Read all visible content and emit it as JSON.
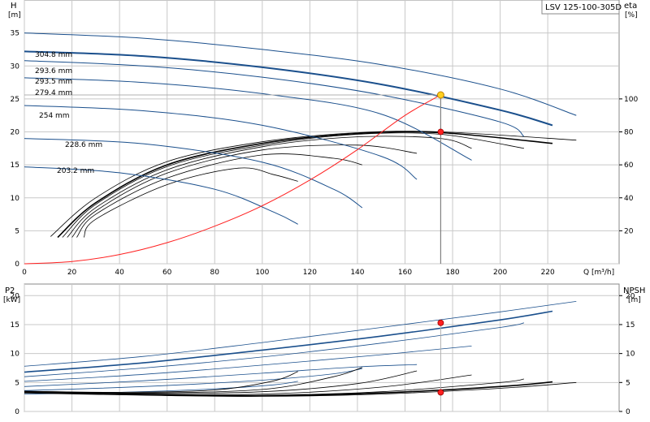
{
  "chart_data": [
    {
      "id": "head",
      "type": "line",
      "title": "LSV 125-100-305D",
      "left_axis_title": "H",
      "left_axis_unit": "[m]",
      "right_axis_title": "eta",
      "right_axis_unit": "[%]",
      "xlabel": "Q [m³/h]",
      "xlim": [
        0,
        250
      ],
      "ylim": [
        0,
        40
      ],
      "y2lim": [
        0,
        160
      ],
      "xticks": [
        0,
        20,
        40,
        60,
        80,
        100,
        120,
        140,
        160,
        180,
        200,
        220
      ],
      "yticks": [
        0,
        5,
        10,
        15,
        20,
        25,
        30,
        35
      ],
      "y2ticks": [
        20,
        40,
        60,
        80,
        100
      ],
      "grid": true,
      "colors": {
        "blue": "#1a4f8c",
        "black": "#000000",
        "red": "#ff2020",
        "duty_marker": "#ffd020",
        "grid": "#c8c8c8"
      },
      "series": [
        {
          "name": "304.8 mm",
          "x": [
            0,
            50,
            100,
            150,
            200,
            232
          ],
          "y": [
            35.0,
            34.2,
            32.5,
            30.2,
            26.5,
            22.5
          ]
        },
        {
          "name": "293.6 mm",
          "x": [
            0,
            50,
            100,
            150,
            200,
            222
          ],
          "y": [
            32.2,
            31.5,
            29.8,
            27.2,
            23.3,
            21.0
          ]
        },
        {
          "name": "293.5 mm",
          "x": [
            0,
            50,
            100,
            150,
            200,
            210
          ],
          "y": [
            30.8,
            30.0,
            28.3,
            25.6,
            21.5,
            19.3
          ]
        },
        {
          "name": "279.4 mm",
          "x": [
            0,
            50,
            100,
            150,
            188
          ],
          "y": [
            28.2,
            27.5,
            25.8,
            22.7,
            15.7
          ]
        },
        {
          "name": "254 mm",
          "x": [
            0,
            50,
            100,
            150,
            165
          ],
          "y": [
            24.0,
            23.2,
            21.0,
            16.3,
            12.8
          ]
        },
        {
          "name": "228.6 mm",
          "x": [
            0,
            50,
            100,
            130,
            142
          ],
          "y": [
            19.0,
            18.2,
            15.4,
            11.3,
            8.5
          ]
        },
        {
          "name": "203.2 mm",
          "x": [
            0,
            40,
            80,
            105,
            115
          ],
          "y": [
            14.7,
            13.8,
            11.3,
            7.8,
            6.0
          ]
        }
      ],
      "efficiency_curves": [
        {
          "x": [
            11,
            30,
            60,
            100,
            140,
            175,
            232
          ],
          "y": [
            16.5,
            40,
            62,
            74,
            79.5,
            80,
            75
          ]
        },
        {
          "x": [
            14,
            30,
            60,
            100,
            140,
            175,
            222
          ],
          "y": [
            16,
            37,
            60,
            73,
            79,
            79.5,
            73
          ]
        },
        {
          "x": [
            16,
            30,
            60,
            100,
            140,
            175,
            210
          ],
          "y": [
            16,
            36,
            59,
            72,
            78.5,
            78.5,
            70
          ]
        },
        {
          "x": [
            18,
            30,
            60,
            100,
            140,
            175,
            188
          ],
          "y": [
            16,
            34,
            57,
            71,
            77,
            76,
            70
          ]
        },
        {
          "x": [
            20,
            30,
            60,
            100,
            140,
            165
          ],
          "y": [
            16,
            32,
            55,
            69,
            72,
            67
          ]
        },
        {
          "x": [
            22,
            30,
            60,
            100,
            130,
            142
          ],
          "y": [
            16,
            30,
            52,
            66,
            64,
            60
          ]
        },
        {
          "x": [
            25,
            30,
            60,
            90,
            105,
            115
          ],
          "y": [
            16,
            27,
            48,
            58,
            54,
            50
          ]
        }
      ],
      "system_curve": {
        "x": [
          0,
          20,
          40,
          60,
          80,
          100,
          120,
          140,
          160,
          175
        ],
        "y": [
          0,
          0.35,
          1.4,
          3.2,
          5.7,
          8.8,
          12.7,
          17.3,
          22.5,
          25.6
        ]
      },
      "duty_point": {
        "q": 175,
        "h": 25.6,
        "eta": 80
      },
      "curve_labels": [
        "304.8 mm",
        "293.6 mm",
        "293.5 mm",
        "279.4 mm",
        "254 mm",
        "228.6 mm",
        "203.2 mm"
      ]
    },
    {
      "id": "power",
      "type": "line",
      "left_axis_title": "P2",
      "left_axis_unit": "[kW]",
      "right_axis_title": "NPSH",
      "right_axis_unit": "[m]",
      "xlim": [
        0,
        250
      ],
      "ylim": [
        0,
        22
      ],
      "y2lim": [
        0,
        22
      ],
      "yticks": [
        0,
        5,
        10,
        15,
        20
      ],
      "y2ticks": [
        0,
        5,
        10,
        15,
        20
      ],
      "grid": true,
      "series": [
        {
          "x": [
            0,
            50,
            100,
            150,
            200,
            232
          ],
          "y": [
            7.8,
            9.5,
            11.9,
            14.5,
            17.2,
            19.0
          ]
        },
        {
          "x": [
            0,
            50,
            100,
            150,
            200,
            222
          ],
          "y": [
            6.8,
            8.4,
            10.6,
            13.0,
            15.8,
            17.3
          ]
        },
        {
          "x": [
            0,
            50,
            100,
            150,
            200,
            210
          ],
          "y": [
            6.0,
            7.5,
            9.4,
            11.8,
            14.5,
            15.3
          ]
        },
        {
          "x": [
            0,
            50,
            100,
            150,
            188
          ],
          "y": [
            5.2,
            6.4,
            8.0,
            9.8,
            11.3
          ]
        },
        {
          "x": [
            0,
            50,
            100,
            140,
            165
          ],
          "y": [
            4.3,
            5.3,
            6.6,
            7.7,
            8.1
          ]
        },
        {
          "x": [
            0,
            50,
            100,
            130,
            142
          ],
          "y": [
            3.6,
            4.3,
            5.4,
            6.5,
            7.4
          ]
        },
        {
          "x": [
            0,
            40,
            80,
            105,
            115
          ],
          "y": [
            3.0,
            3.3,
            3.9,
            4.6,
            5.2
          ]
        }
      ],
      "npsh_curves": [
        {
          "x": [
            0,
            50,
            100,
            150,
            200,
            232
          ],
          "y": [
            3.2,
            2.8,
            2.6,
            3.0,
            4.0,
            5.0
          ]
        },
        {
          "x": [
            0,
            50,
            100,
            150,
            200,
            222
          ],
          "y": [
            3.3,
            2.9,
            2.7,
            3.2,
            4.3,
            5.1
          ]
        },
        {
          "x": [
            0,
            50,
            100,
            150,
            200,
            210
          ],
          "y": [
            3.3,
            2.9,
            2.8,
            3.4,
            5.0,
            5.6
          ]
        },
        {
          "x": [
            0,
            50,
            100,
            150,
            188
          ],
          "y": [
            3.4,
            3.0,
            3.0,
            4.2,
            6.3
          ]
        },
        {
          "x": [
            0,
            50,
            100,
            140,
            165
          ],
          "y": [
            3.4,
            3.1,
            3.4,
            4.8,
            7.0
          ]
        },
        {
          "x": [
            0,
            50,
            100,
            130,
            142
          ],
          "y": [
            3.5,
            3.2,
            3.8,
            6.0,
            7.6
          ]
        },
        {
          "x": [
            0,
            40,
            80,
            105,
            115
          ],
          "y": [
            3.5,
            3.3,
            3.7,
            5.3,
            6.9
          ]
        }
      ],
      "duty_power": {
        "q": 175,
        "p2": 15.3
      },
      "duty_npsh": {
        "q": 175,
        "npsh": 3.3
      }
    }
  ]
}
